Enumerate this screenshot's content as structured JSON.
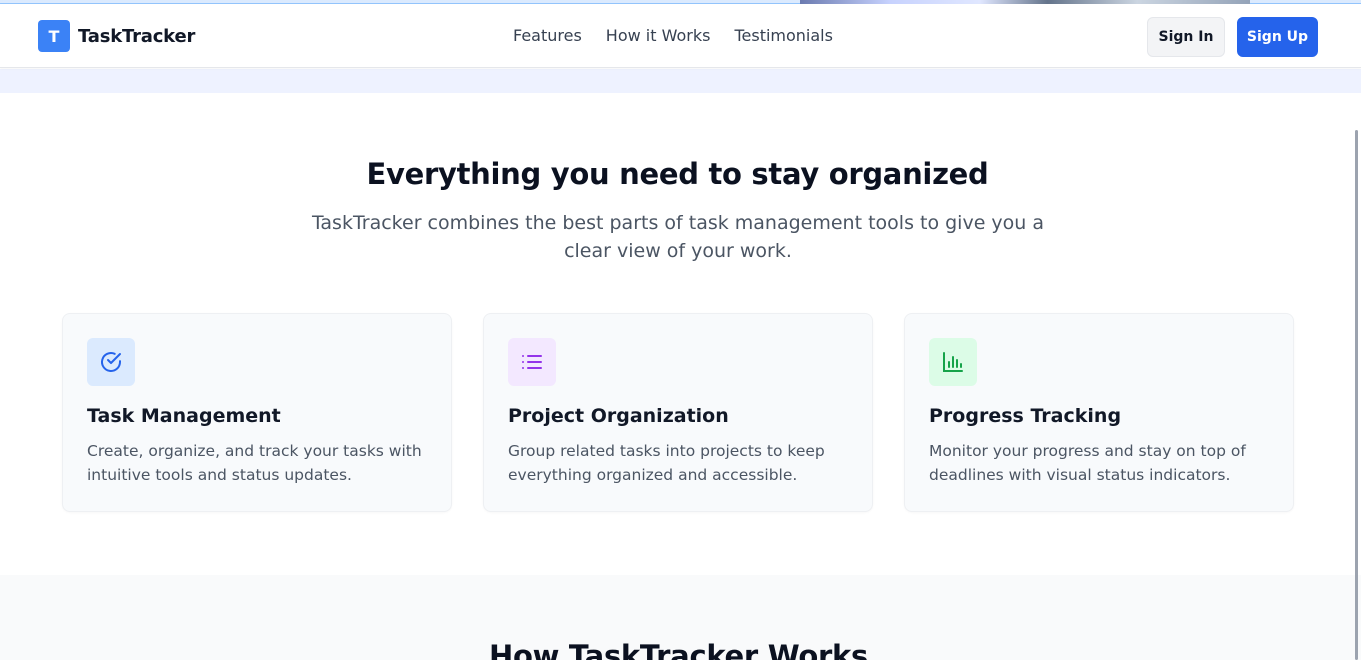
{
  "brand": {
    "logo_letter": "T",
    "name": "TaskTracker",
    "accent_color": "#3b82f6",
    "primary_button_color": "#2563eb"
  },
  "nav": {
    "links": [
      "Features",
      "How it Works",
      "Testimonials"
    ],
    "sign_in_label": "Sign In",
    "sign_up_label": "Sign Up"
  },
  "features": {
    "title": "Everything you need to stay organized",
    "subtitle": "TaskTracker combines the best parts of task management tools to give you a clear view of your work.",
    "cards": [
      {
        "icon": "check-circle-icon",
        "icon_color": "#2563eb",
        "icon_bg": "#dbeafe",
        "title": "Task Management",
        "description": "Create, organize, and track your tasks with intuitive tools and status updates."
      },
      {
        "icon": "list-icon",
        "icon_color": "#9333ea",
        "icon_bg": "#f3e8ff",
        "title": "Project Organization",
        "description": "Group related tasks into projects to keep everything organized and accessible."
      },
      {
        "icon": "bar-chart-icon",
        "icon_color": "#16a34a",
        "icon_bg": "#dcfce7",
        "title": "Progress Tracking",
        "description": "Monitor your progress and stay on top of deadlines with visual status indicators."
      }
    ]
  },
  "how_it_works": {
    "title": "How TaskTracker Works"
  }
}
